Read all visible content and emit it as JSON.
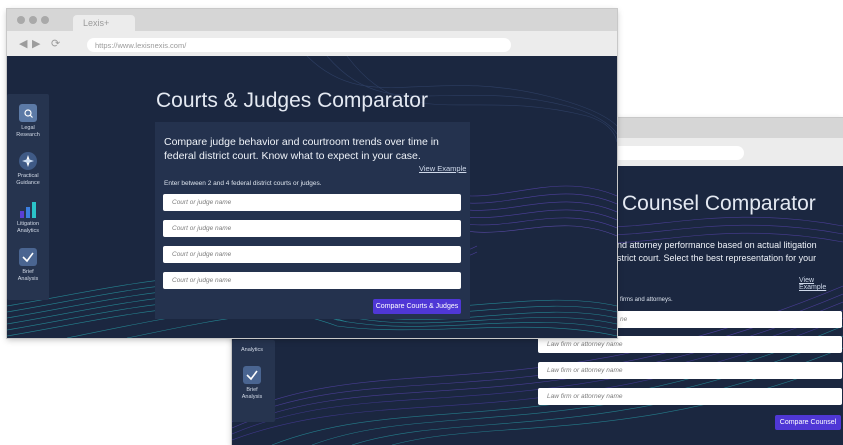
{
  "browser": {
    "tab_title": "Lexis+",
    "url": "https://www.lexisnexis.com/"
  },
  "sidebar": {
    "items": [
      {
        "label1": "Legal",
        "label2": "Research",
        "icon": "search-icon"
      },
      {
        "label1": "Practical",
        "label2": "Guidance",
        "icon": "compass-icon"
      },
      {
        "label1": "Litigation",
        "label2": "Analytics",
        "icon": "bar-chart-icon"
      },
      {
        "label1": "Brief",
        "label2": "Analysis",
        "icon": "checkmark-document-icon"
      }
    ]
  },
  "courts": {
    "title": "Courts & Judges Comparator",
    "description": "Compare judge behavior and courtroom trends over time in federal district court. Know what to expect in your case.",
    "view_example": "View Example",
    "instruction": "Enter between 2 and 4 federal district courts or judges.",
    "placeholder": "Court or judge name",
    "button": "Compare Courts & Judges"
  },
  "counsel": {
    "title": "Counsel Comparator",
    "description_line1": "nd attorney performance based on actual litigation",
    "description_line2": "strict court. Select the best representation for your",
    "view_example": "View Example",
    "instruction": "firms and attorneys.",
    "partial_field": "ne",
    "placeholder": "Law firm or attorney name",
    "sidebar_analytics": "Analytics",
    "button": "Compare Counsel"
  },
  "colors": {
    "background": "#1b2740",
    "panel": "#24324e",
    "button": "#4f37d6",
    "wave_purple": "#6e4fd8",
    "wave_teal": "#2bc3c8"
  }
}
